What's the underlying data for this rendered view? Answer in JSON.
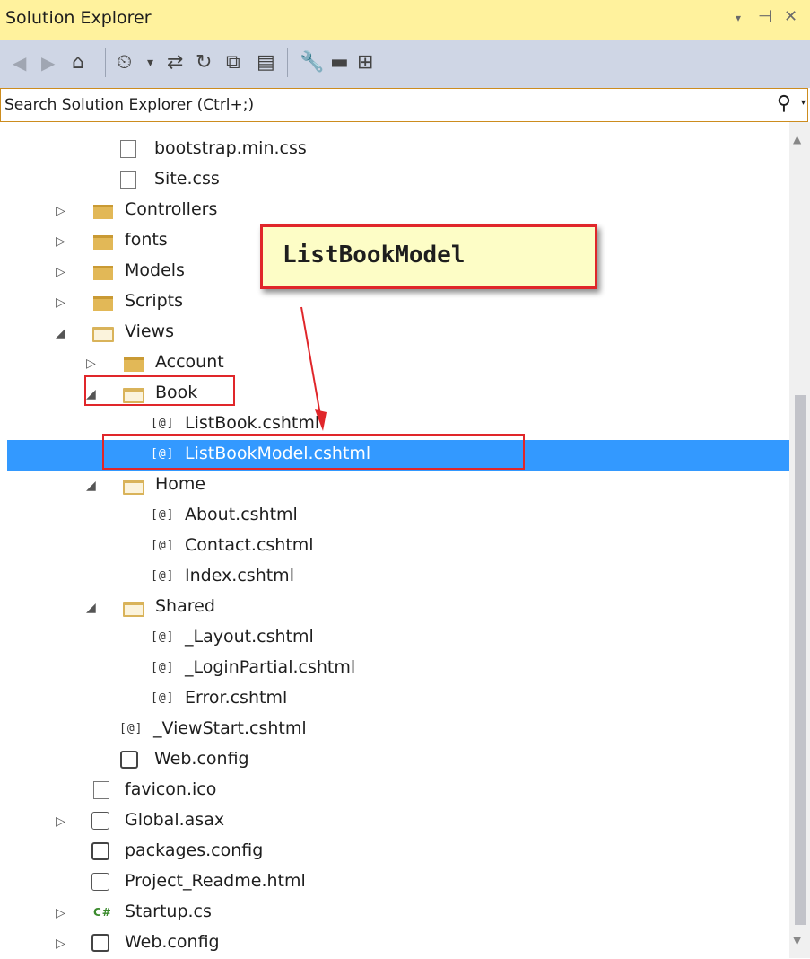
{
  "window": {
    "title": "Solution Explorer",
    "controls": [
      "▾",
      "⊣",
      "✕"
    ]
  },
  "toolbar": {
    "icons": [
      "back-icon",
      "forward-icon",
      "home-icon",
      "pending-changes-icon",
      "dropdown-icon",
      "sync-icon",
      "refresh-icon",
      "collapse-all-icon",
      "show-all-files-icon",
      "properties-icon",
      "preview-icon",
      "class-view-icon"
    ]
  },
  "search": {
    "placeholder": "Search Solution Explorer (Ctrl+;)"
  },
  "tree": {
    "items": [
      {
        "label": "bootstrap.min.css",
        "type": "css",
        "expander": ""
      },
      {
        "label": "Site.css",
        "type": "css",
        "expander": ""
      },
      {
        "label": "Controllers",
        "type": "folder",
        "expander": "collapsed"
      },
      {
        "label": "fonts",
        "type": "folder",
        "expander": "collapsed"
      },
      {
        "label": "Models",
        "type": "folder",
        "expander": "collapsed"
      },
      {
        "label": "Scripts",
        "type": "folder",
        "expander": "collapsed"
      },
      {
        "label": "Views",
        "type": "folder-open",
        "expander": "expanded"
      },
      {
        "label": "Account",
        "type": "folder",
        "expander": "collapsed"
      },
      {
        "label": "Book",
        "type": "folder-open",
        "expander": "expanded"
      },
      {
        "label": "ListBook.cshtml",
        "type": "razor",
        "expander": ""
      },
      {
        "label": "ListBookModel.cshtml",
        "type": "razor",
        "expander": "",
        "selected": true
      },
      {
        "label": "Home",
        "type": "folder-open",
        "expander": "expanded"
      },
      {
        "label": "About.cshtml",
        "type": "razor",
        "expander": ""
      },
      {
        "label": "Contact.cshtml",
        "type": "razor",
        "expander": ""
      },
      {
        "label": "Index.cshtml",
        "type": "razor",
        "expander": ""
      },
      {
        "label": "Shared",
        "type": "folder-open",
        "expander": "expanded"
      },
      {
        "label": "_Layout.cshtml",
        "type": "razor",
        "expander": ""
      },
      {
        "label": "_LoginPartial.cshtml",
        "type": "razor",
        "expander": ""
      },
      {
        "label": "Error.cshtml",
        "type": "razor",
        "expander": ""
      },
      {
        "label": "_ViewStart.cshtml",
        "type": "razor",
        "expander": ""
      },
      {
        "label": "Web.config",
        "type": "config",
        "expander": ""
      },
      {
        "label": "favicon.ico",
        "type": "ico",
        "expander": ""
      },
      {
        "label": "Global.asax",
        "type": "asax",
        "expander": "collapsed"
      },
      {
        "label": "packages.config",
        "type": "config",
        "expander": ""
      },
      {
        "label": "Project_Readme.html",
        "type": "html",
        "expander": ""
      },
      {
        "label": "Startup.cs",
        "type": "cs",
        "expander": "collapsed"
      },
      {
        "label": "Web.config",
        "type": "config",
        "expander": "collapsed"
      }
    ],
    "razor_glyph": "[@]",
    "cs_glyph": "C#",
    "expander_glyphs": {
      "collapsed": "▷",
      "expanded": "◢"
    }
  },
  "annotation": {
    "callout_text": "ListBookModel",
    "highlight_color": "#e0262a"
  },
  "colors": {
    "title_bar": "#fff29d",
    "toolbar": "#cfd6e5",
    "selection": "#3399ff",
    "search_border": "#cc8c1e"
  }
}
